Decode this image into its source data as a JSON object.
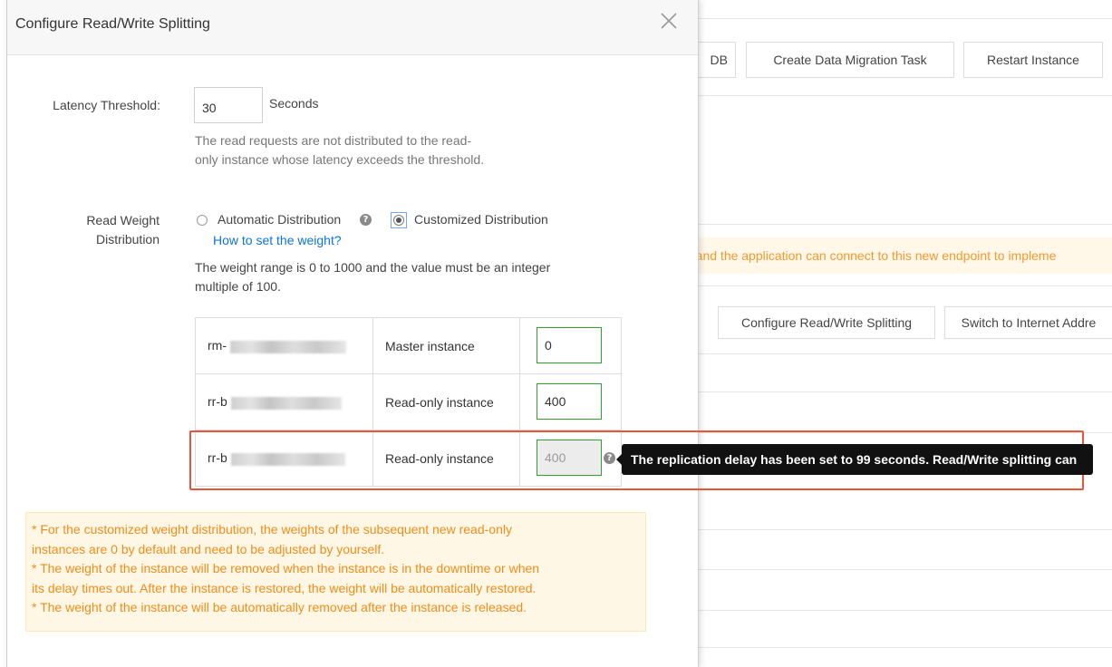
{
  "background": {
    "toolbar_buttons": [
      "DB",
      "Create Data Migration Task",
      "Restart Instance"
    ],
    "notice_text": "d and the application can connect to this new endpoint to impleme",
    "action_buttons": [
      "Configure Read/Write Splitting",
      "Switch to Internet Addre"
    ]
  },
  "modal": {
    "title": "Configure Read/Write Splitting",
    "close_icon": "close-icon",
    "latency": {
      "label": "Latency Threshold:",
      "value": "30",
      "unit": "Seconds",
      "help_line1": "The read requests are not distributed to the read-",
      "help_line2": "only instance whose latency exceeds the threshold."
    },
    "distribution": {
      "label_line1": "Read Weight",
      "label_line2": "Distribution",
      "option_auto": "Automatic Distribution",
      "option_custom": "Customized Distribution",
      "selected": "Customized Distribution",
      "howto_link": "How to set the weight?",
      "range_line1": "The weight range is 0 to 1000 and the value must be an integer",
      "range_line2": "multiple of 100."
    },
    "instances": [
      {
        "id_prefix": "rm-",
        "type": "Master instance",
        "weight": "0",
        "editable": true
      },
      {
        "id_prefix": "rr-b",
        "type": "Read-only instance",
        "weight": "400",
        "editable": true
      },
      {
        "id_prefix": "rr-b",
        "type": "Read-only instance",
        "weight": "400",
        "editable": false
      }
    ],
    "tooltip": "The replication delay has been set to 99 seconds. Read/Write splitting can",
    "notes": [
      "* For the customized weight distribution, the weights of the subsequent new read-only",
      "instances are 0 by default and need to be adjusted by yourself.",
      "* The weight of the instance will be removed when the instance is in the downtime or when",
      "its delay times out. After the instance is restored, the weight will be automatically restored.",
      "* The weight of the instance will be automatically removed after the instance is released."
    ],
    "colors": {
      "highlight_border": "#e8553b",
      "input_valid_border": "#2fa12f",
      "link": "#0d74d9",
      "note_text": "#ef8d1a",
      "note_bg": "#fff7e6",
      "tooltip_bg": "#111111"
    }
  }
}
